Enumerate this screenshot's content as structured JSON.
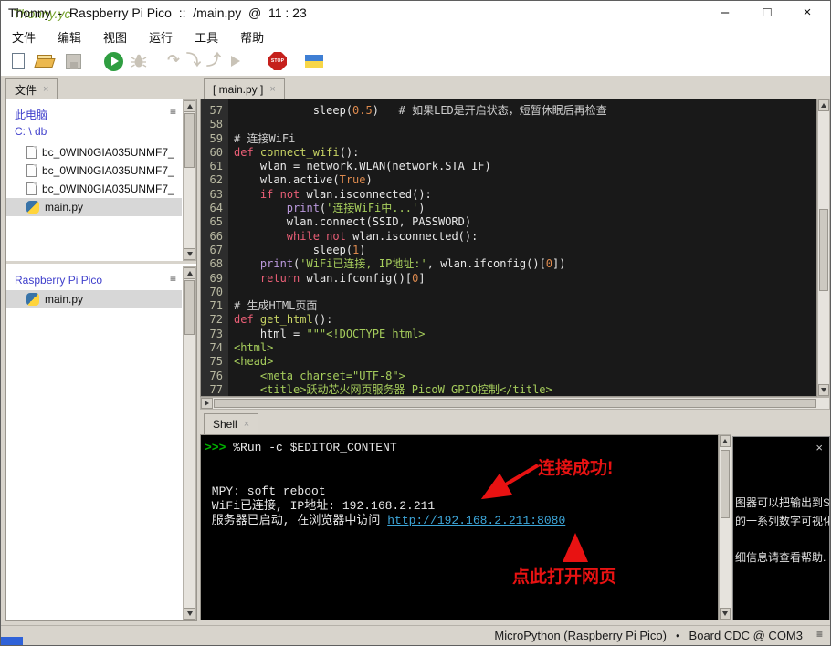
{
  "ui": {
    "close_glyph": "×",
    "menu_glyph": "≡",
    "min_glyph": "–",
    "max_glyph": "□",
    "step_over_glyph": "↷",
    "step_into_glyph": "⤵",
    "step_out_glyph": "⤴"
  },
  "window": {
    "title": "Thonny  -  Raspberry Pi Pico  ::  /main.py  @  11 : 23",
    "title_green": "Thonny.yc"
  },
  "menu": {
    "items": [
      "文件",
      "编辑",
      "视图",
      "运行",
      "工具",
      "帮助"
    ]
  },
  "toolbar": {
    "stop_label": "STOP",
    "icons": [
      "new-file",
      "open-file",
      "save-file",
      "run-script",
      "debug-script",
      "step-over",
      "step-into",
      "step-out",
      "resume",
      "stop-restart",
      "ukraine-flag"
    ]
  },
  "files": {
    "tab_label": "文件",
    "sections": [
      {
        "title": "此电脑",
        "path": "C: \\ db",
        "rows": [
          {
            "icon": "doc",
            "label": "bc_0WIN0GIA035UNMF7_",
            "selected": false
          },
          {
            "icon": "doc",
            "label": "bc_0WIN0GIA035UNMF7_",
            "selected": false
          },
          {
            "icon": "doc",
            "label": "bc_0WIN0GIA035UNMF7_",
            "selected": false
          },
          {
            "icon": "py",
            "label": "main.py",
            "selected": true
          }
        ]
      },
      {
        "title": "Raspberry Pi Pico",
        "rows": [
          {
            "icon": "py",
            "label": "main.py",
            "selected": true
          }
        ]
      }
    ]
  },
  "editor": {
    "tab_label": "[ main.py ]",
    "lines": [
      {
        "n": "57",
        "seg": [
          [
            "            sleep(",
            "d"
          ],
          [
            "0.5",
            "n"
          ],
          [
            ")   ",
            "d"
          ],
          [
            "# 如果LED是开启状态，短暂休眠后再检查",
            "c"
          ]
        ]
      },
      {
        "n": "58",
        "seg": []
      },
      {
        "n": "59",
        "seg": [
          [
            "# 连接WiFi",
            "c"
          ]
        ]
      },
      {
        "n": "60",
        "seg": [
          [
            "def",
            "k"
          ],
          [
            " ",
            "d"
          ],
          [
            "connect_wifi",
            "f"
          ],
          [
            "():",
            "d"
          ]
        ]
      },
      {
        "n": "61",
        "seg": [
          [
            "    wlan = network.WLAN(network.STA_IF)",
            "d"
          ]
        ]
      },
      {
        "n": "62",
        "seg": [
          [
            "    wlan.active(",
            "d"
          ],
          [
            "True",
            "n"
          ],
          [
            ")",
            "d"
          ]
        ]
      },
      {
        "n": "63",
        "seg": [
          [
            "    ",
            "d"
          ],
          [
            "if",
            "k"
          ],
          [
            " ",
            "d"
          ],
          [
            "not",
            "k"
          ],
          [
            " wlan.isconnected():",
            "d"
          ]
        ]
      },
      {
        "n": "64",
        "seg": [
          [
            "        ",
            "d"
          ],
          [
            "print",
            "b"
          ],
          [
            "(",
            "d"
          ],
          [
            "'连接WiFi中...'",
            "s"
          ],
          [
            ")",
            "d"
          ]
        ]
      },
      {
        "n": "65",
        "seg": [
          [
            "        wlan.connect(SSID, PASSWORD)",
            "d"
          ]
        ]
      },
      {
        "n": "66",
        "seg": [
          [
            "        ",
            "d"
          ],
          [
            "while",
            "k"
          ],
          [
            " ",
            "d"
          ],
          [
            "not",
            "k"
          ],
          [
            " wlan.isconnected():",
            "d"
          ]
        ]
      },
      {
        "n": "67",
        "seg": [
          [
            "            sleep(",
            "d"
          ],
          [
            "1",
            "n"
          ],
          [
            ")",
            "d"
          ]
        ]
      },
      {
        "n": "68",
        "seg": [
          [
            "    ",
            "d"
          ],
          [
            "print",
            "b"
          ],
          [
            "(",
            "d"
          ],
          [
            "'WiFi已连接, IP地址:'",
            "s"
          ],
          [
            ", wlan.ifconfig()[",
            "d"
          ],
          [
            "0",
            "n"
          ],
          [
            "])",
            "d"
          ]
        ]
      },
      {
        "n": "69",
        "seg": [
          [
            "    ",
            "d"
          ],
          [
            "return",
            "k"
          ],
          [
            " wlan.ifconfig()[",
            "d"
          ],
          [
            "0",
            "n"
          ],
          [
            "]",
            "d"
          ]
        ]
      },
      {
        "n": "70",
        "seg": []
      },
      {
        "n": "71",
        "seg": [
          [
            "# 生成HTML页面",
            "c"
          ]
        ]
      },
      {
        "n": "72",
        "seg": [
          [
            "def",
            "k"
          ],
          [
            " ",
            "d"
          ],
          [
            "get_html",
            "f"
          ],
          [
            "():",
            "d"
          ]
        ]
      },
      {
        "n": "73",
        "seg": [
          [
            "    html = ",
            "d"
          ],
          [
            "\"\"\"<!DOCTYPE html>",
            "s"
          ]
        ]
      },
      {
        "n": "74",
        "seg": [
          [
            "<html>",
            "s"
          ]
        ]
      },
      {
        "n": "75",
        "seg": [
          [
            "<head>",
            "s"
          ]
        ]
      },
      {
        "n": "76",
        "seg": [
          [
            "    <meta charset=\"UTF-8\">",
            "s"
          ]
        ]
      },
      {
        "n": "77",
        "seg": [
          [
            "    <title>跃动芯火网页服务器 PicoW GPIO控制</title>",
            "s"
          ]
        ]
      }
    ]
  },
  "shell": {
    "tab_label": "Shell",
    "lines": [
      [
        [
          ">>> ",
          "p"
        ],
        [
          "%Run -c $EDITOR_CONTENT",
          "o"
        ]
      ],
      [],
      [],
      [
        [
          " MPY: soft reboot",
          "o"
        ]
      ],
      [
        [
          " WiFi已连接, IP地址: 192.168.2.211",
          "o"
        ]
      ],
      [
        [
          " 服务器已启动, 在浏览器中访问 ",
          "o"
        ],
        [
          "http://192.168.2.211:8080",
          "l"
        ]
      ]
    ],
    "annotations": {
      "success": "连接成功!",
      "open_hint": "点此打开网页"
    }
  },
  "plotter": {
    "lines": [
      "图器可以把输出到S",
      "的一系列数字可视化",
      "",
      "细信息请查看帮助."
    ]
  },
  "status": {
    "interpreter": "MicroPython (Raspberry Pi Pico)",
    "bullet": "•",
    "port": "Board CDC @ COM3"
  },
  "colors": {
    "annotation_red": "#e81212",
    "link_blue": "#3da6d9",
    "prompt_green": "#00b400",
    "header_blue": "#4040cc",
    "editor_bg": "#191919",
    "shell_bg": "#000000",
    "keyword": "#ea5e76",
    "string": "#a6cd5c",
    "number": "#dd8a4e",
    "builtin": "#bb99dd",
    "defname": "#c8d464",
    "comment": "#cfcfcf",
    "run_green": "#2f9e41",
    "stop_red": "#c5201c",
    "flag_blue": "#3f7fd4",
    "flag_yellow": "#f7d648"
  }
}
